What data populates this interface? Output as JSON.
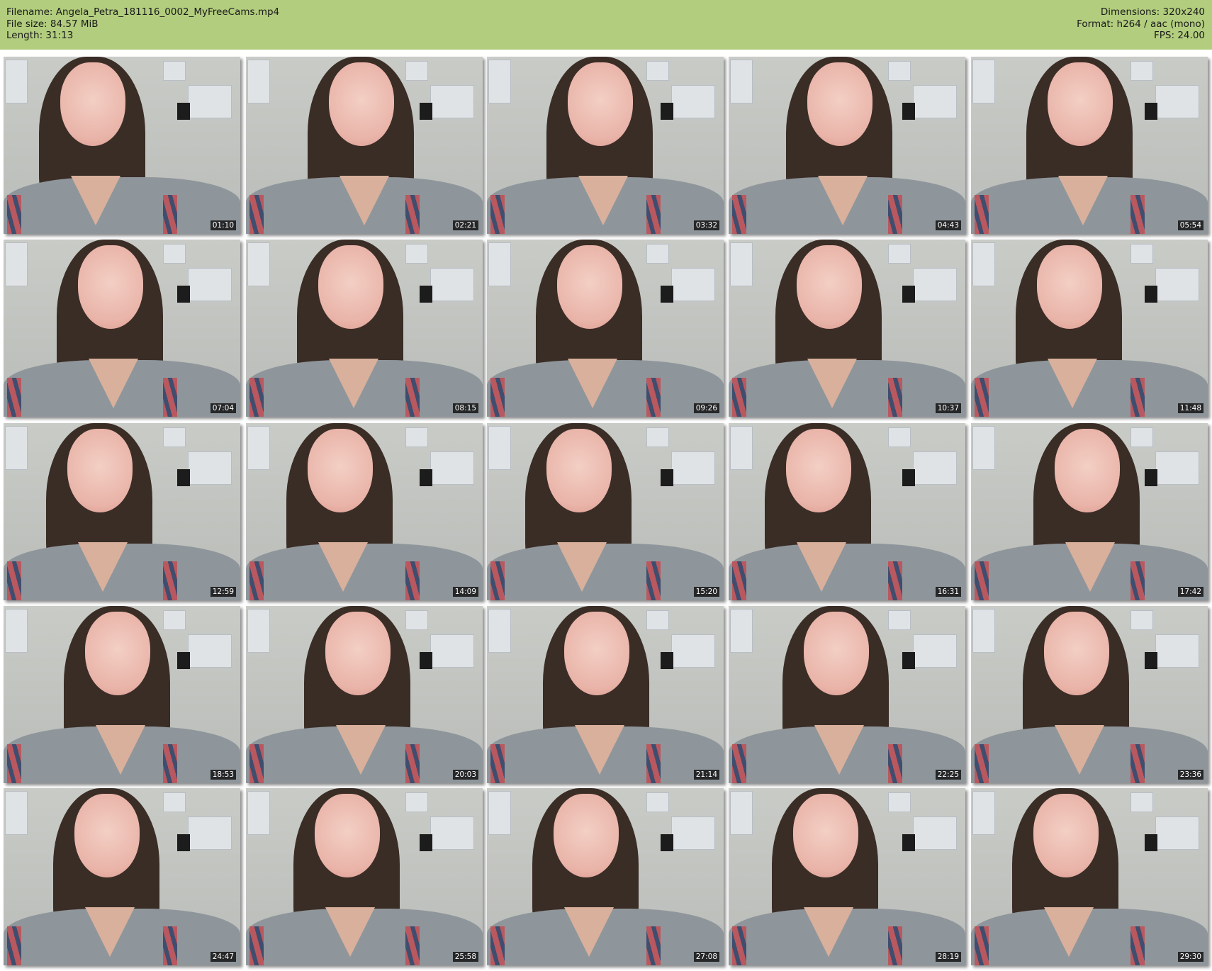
{
  "header": {
    "filename": "Filename: Angela_Petra_181116_0002_MyFreeCams.mp4",
    "file_size": "File size: 84.57 MiB",
    "length": "Length: 31:13",
    "dimensions": "Dimensions: 320x240",
    "format": "Format: h264 / aac (mono)",
    "fps": "FPS: 24.00"
  },
  "colors": {
    "header_bg": "#b2cd7e"
  },
  "thumbnails": [
    "01:10",
    "02:21",
    "03:32",
    "04:43",
    "05:54",
    "07:04",
    "08:15",
    "09:26",
    "10:37",
    "11:48",
    "12:59",
    "14:09",
    "15:20",
    "16:31",
    "17:42",
    "18:53",
    "20:03",
    "21:14",
    "22:25",
    "23:36",
    "24:47",
    "25:58",
    "27:08",
    "28:19",
    "29:30"
  ]
}
